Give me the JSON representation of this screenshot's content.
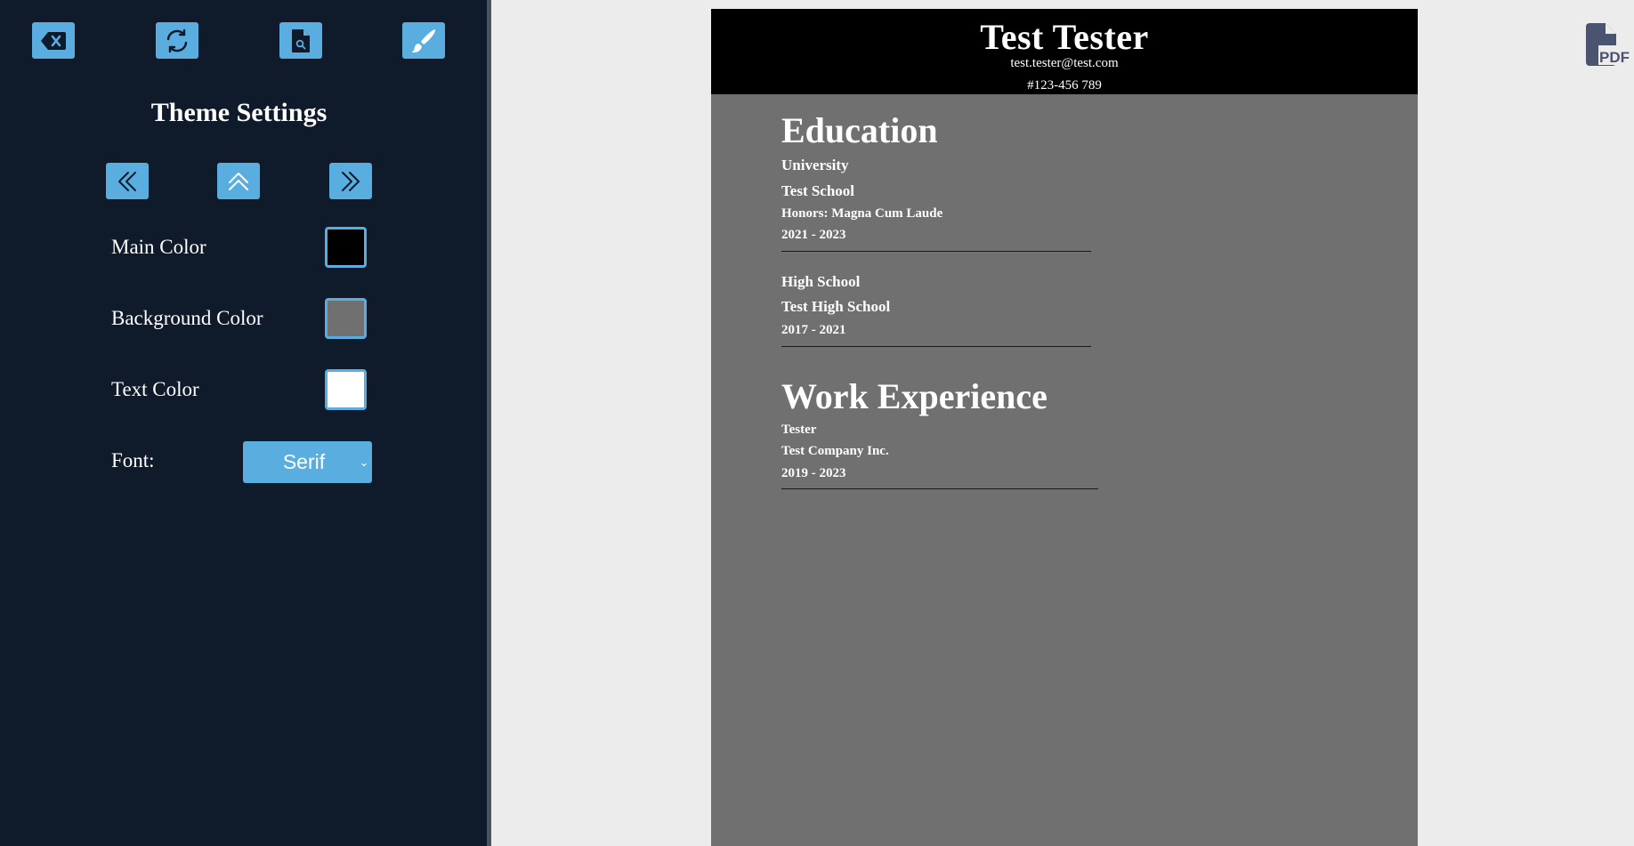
{
  "toolbar": {
    "clear_icon": "backspace-icon",
    "reset_icon": "refresh-icon",
    "preview_icon": "file-search-icon",
    "theme_icon": "paintbrush-icon"
  },
  "theme_settings": {
    "title": "Theme Settings",
    "nav": [
      "chevrons-left-icon",
      "chevrons-up-icon",
      "chevrons-right-icon"
    ],
    "main_color_label": "Main Color",
    "main_color": "#000000",
    "background_color_label": "Background Color",
    "background_color": "#707070",
    "text_color_label": "Text Color",
    "text_color": "#ffffff",
    "font_label": "Font:",
    "font_value": "Serif"
  },
  "resume": {
    "name": "Test Tester",
    "email": "test.tester@test.com",
    "phone": "#123-456 789",
    "education_heading": "Education",
    "education": [
      {
        "level": "University",
        "school": "Test School",
        "honors": "Honors: Magna Cum Laude",
        "years": "2021 - 2023"
      },
      {
        "level": "High School",
        "school": "Test High School",
        "years": "2017 - 2021"
      }
    ],
    "work_heading": "Work Experience",
    "work": [
      {
        "title": "Tester",
        "company": "Test Company Inc.",
        "years": "2019 - 2023"
      }
    ]
  },
  "pdf_icon": {
    "name": "pdf-file-icon",
    "text": "PDF"
  },
  "colors": {
    "sidebar": "#0f1a2b",
    "accent": "#5aaddf",
    "canvas": "#ececec",
    "pdf_icon": "#4a5370"
  }
}
